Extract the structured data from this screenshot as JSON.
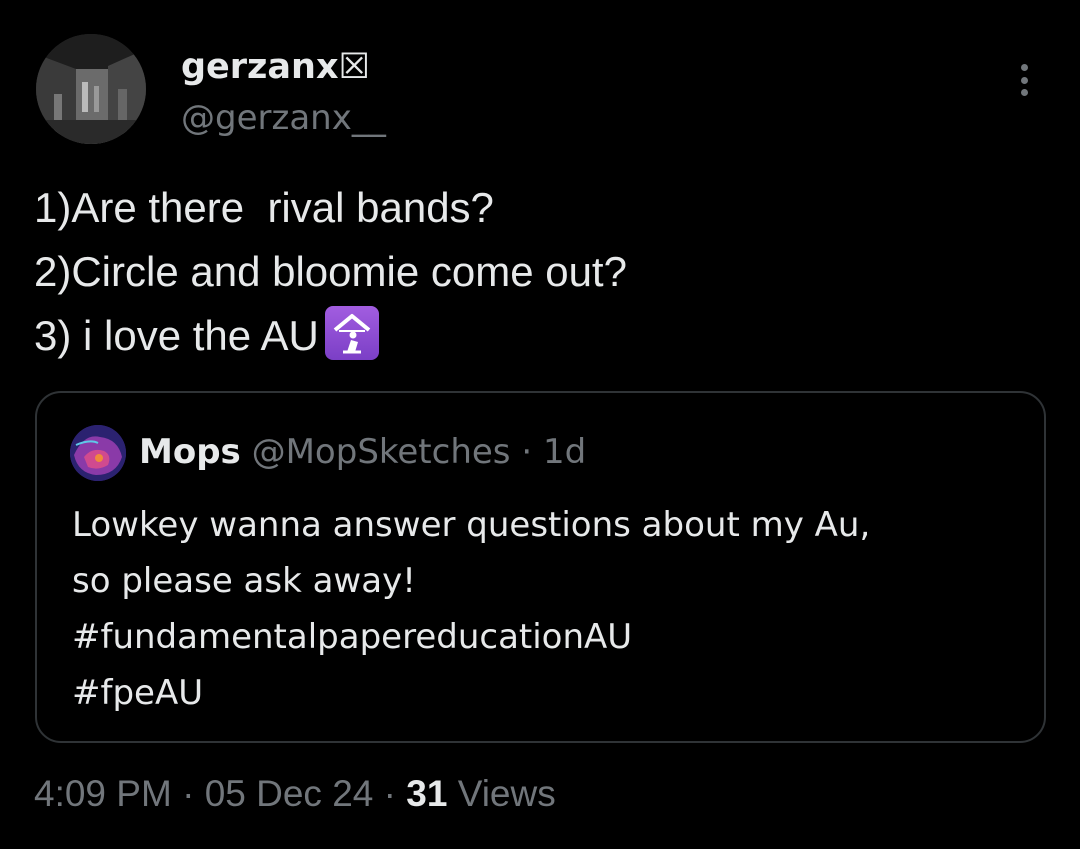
{
  "author": {
    "display_name": "gerzanx☒",
    "handle": "@gerzanx__",
    "avatar_icon": "profile-photo"
  },
  "more_icon": "more-options-icon",
  "tweet": {
    "lines": [
      "1)Are there  rival bands?",
      "2)Circle and bloomie come out?",
      "3) i love the AU"
    ],
    "emoji": "place-of-worship-emoji"
  },
  "quote": {
    "display_name": "Mops",
    "handle": "@MopSketches",
    "separator": "·",
    "time": "1d",
    "lines": [
      "Lowkey wanna answer questions about my Au,",
      "so please ask away!",
      "#fundamentalpapereducationAU",
      "#fpeAU"
    ]
  },
  "meta": {
    "time": "4:09 PM",
    "sep1": "·",
    "date": "05 Dec 24",
    "sep2": "·",
    "views_count": "31",
    "views_label": "Views"
  },
  "colors": {
    "background": "#000000",
    "text_primary": "#e7e9ea",
    "text_secondary": "#71767b",
    "border": "#2f3336",
    "emoji_bg": "#9b59d6"
  }
}
